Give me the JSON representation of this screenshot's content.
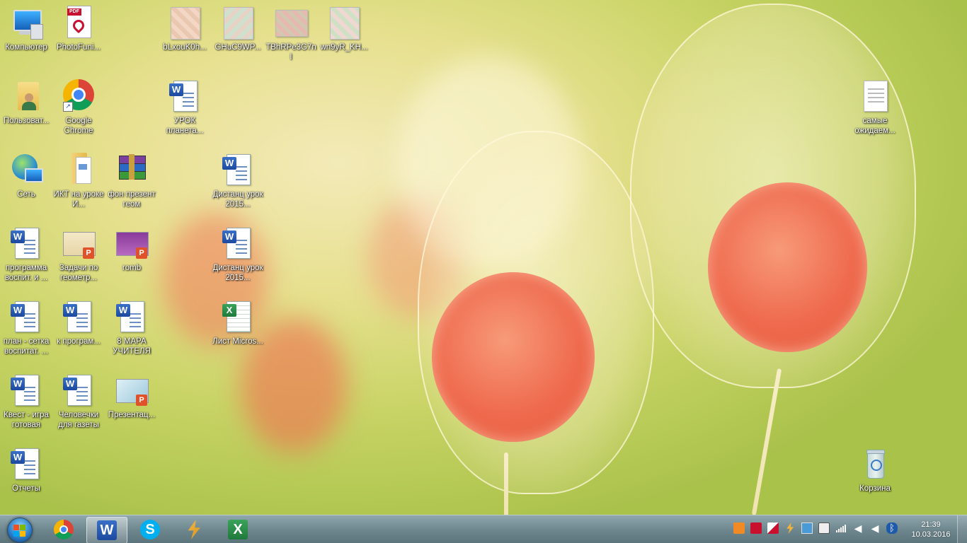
{
  "desktop_icons": [
    {
      "label": "Компьютер"
    },
    {
      "label": "PhotoFuni..."
    },
    {
      "label": "bLxouK0h..."
    },
    {
      "label": "GHuC9WP..."
    },
    {
      "label": "TBhRPe3G7nI"
    },
    {
      "label": "wn9yR_KH..."
    },
    {
      "label": "Пользоват..."
    },
    {
      "label": "Google Chrome"
    },
    {
      "label": "УРОК планета..."
    },
    {
      "label": "самые ожидаем..."
    },
    {
      "label": "Сеть"
    },
    {
      "label": "ИКТ на уроке И..."
    },
    {
      "label": "фон презент геом"
    },
    {
      "label": "Дистанц урок 2015..."
    },
    {
      "label": "программа воспит. и ..."
    },
    {
      "label": "Задачи по геометр..."
    },
    {
      "label": "romb"
    },
    {
      "label": "Дистанц урок 2015..."
    },
    {
      "label": "план - сетка воспитат. ..."
    },
    {
      "label": "к програм..."
    },
    {
      "label": "8 МАРА УЧИТЕЛЯ"
    },
    {
      "label": "Лист Micros..."
    },
    {
      "label": "Квест - игра готовая"
    },
    {
      "label": "Человечки для газеты"
    },
    {
      "label": "Презентац..."
    },
    {
      "label": "Отчеты"
    },
    {
      "label": "Корзина"
    }
  ],
  "taskbar": {
    "clock_time": "21:39",
    "clock_date": "10.03.2016"
  },
  "colors": {
    "taskbar": "#6f878e",
    "word_blue": "#1d4aa0",
    "excel_green": "#1f7a3b",
    "powerpoint_orange": "#e0532a",
    "pdf_red": "#c8102e"
  }
}
